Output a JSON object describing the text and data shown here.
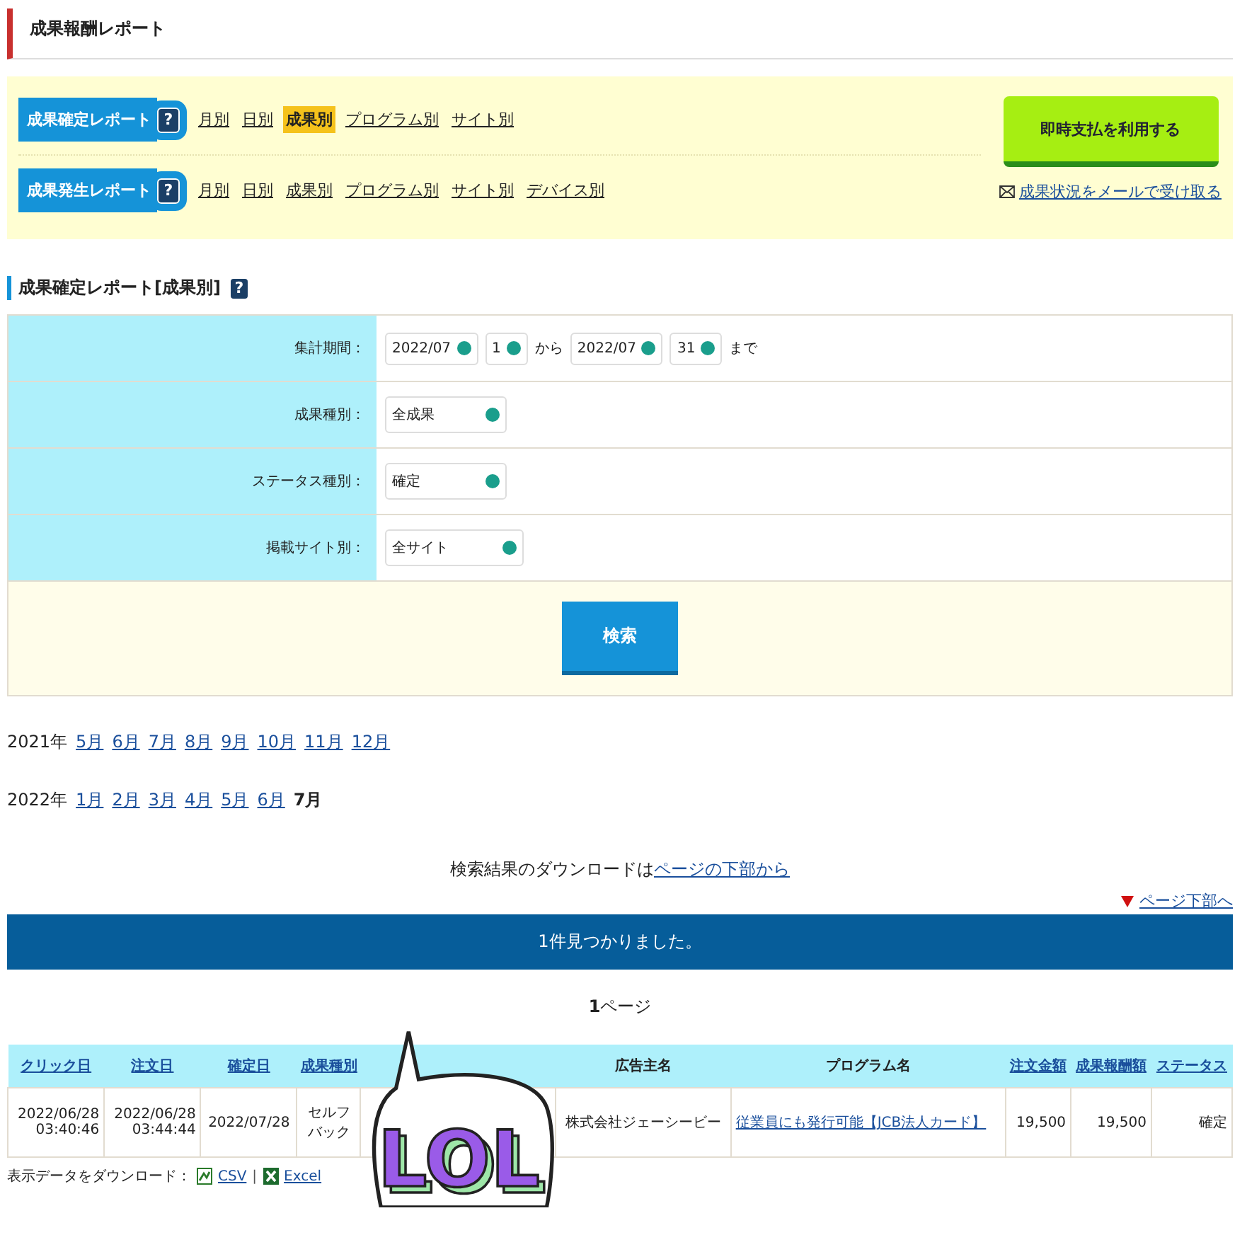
{
  "page_title": "成果報酬レポート",
  "report_nav": [
    {
      "label": "成果確定レポート",
      "help": "?",
      "links": [
        {
          "text": "月別",
          "selected": false
        },
        {
          "text": "日別",
          "selected": false
        },
        {
          "text": "成果別",
          "selected": true
        },
        {
          "text": "プログラム別",
          "selected": false
        },
        {
          "text": "サイト別",
          "selected": false
        }
      ]
    },
    {
      "label": "成果発生レポート",
      "help": "?",
      "links": [
        {
          "text": "月別",
          "selected": false
        },
        {
          "text": "日別",
          "selected": false
        },
        {
          "text": "成果別",
          "selected": false
        },
        {
          "text": "プログラム別",
          "selected": false
        },
        {
          "text": "サイト別",
          "selected": false
        },
        {
          "text": "デバイス別",
          "selected": false
        }
      ]
    }
  ],
  "instant_pay_button": "即時支払を利用する",
  "mail_link": "成果状況をメールで受け取る",
  "section_title": "成果確定レポート[成果別]",
  "section_help": "?",
  "filters": [
    {
      "label": "集計期間：",
      "kind": "range",
      "from_month": "2022/07",
      "from_day": "1",
      "from_sep": "から",
      "to_month": "2022/07",
      "to_day": "31",
      "to_sep": "まで"
    },
    {
      "label": "成果種別：",
      "kind": "select",
      "value": "全成果"
    },
    {
      "label": "ステータス種別：",
      "kind": "select",
      "value": "確定"
    },
    {
      "label": "掲載サイト別：",
      "kind": "select",
      "value": "全サイト"
    }
  ],
  "search_button": "検索",
  "month_rows": [
    {
      "year": "2021年",
      "months": [
        {
          "text": "5月",
          "selected": false
        },
        {
          "text": "6月",
          "selected": false
        },
        {
          "text": "7月",
          "selected": false
        },
        {
          "text": "8月",
          "selected": false
        },
        {
          "text": "9月",
          "selected": false
        },
        {
          "text": "10月",
          "selected": false
        },
        {
          "text": "11月",
          "selected": false
        },
        {
          "text": "12月",
          "selected": false
        }
      ]
    },
    {
      "year": "2022年",
      "months": [
        {
          "text": "1月",
          "selected": false
        },
        {
          "text": "2月",
          "selected": false
        },
        {
          "text": "3月",
          "selected": false
        },
        {
          "text": "4月",
          "selected": false
        },
        {
          "text": "5月",
          "selected": false
        },
        {
          "text": "6月",
          "selected": false
        },
        {
          "text": "7月",
          "selected": true
        }
      ]
    }
  ],
  "download_note": {
    "text": "検索結果のダウンロードは",
    "link": "ページの下部から"
  },
  "page_bottom_link": "ページ下部へ",
  "result_banner": "1件見つかりました。",
  "page_indicator": {
    "number": "1",
    "suffix": "ページ"
  },
  "table": {
    "columns": [
      {
        "label": "クリック日",
        "sortable": true
      },
      {
        "label": "注文日",
        "sortable": true
      },
      {
        "label": "確定日",
        "sortable": true
      },
      {
        "label": "成果種別",
        "sortable": true
      },
      {
        "label": "広告主名",
        "sortable": false
      },
      {
        "label": "プログラム名",
        "sortable": false
      },
      {
        "label": "注文金額",
        "sortable": true
      },
      {
        "label": "成果報酬額",
        "sortable": true
      },
      {
        "label": "ステータス",
        "sortable": true
      }
    ],
    "rows": [
      {
        "cells": [
          "2022/06/28\n03:40:46",
          "2022/06/28\n03:44:44",
          "2022/07/28",
          "セルフバック",
          "株式会社ジェーシービー",
          "従業員にも発行可能【JCB法人カード】",
          "19,500",
          "19,500",
          "確定"
        ]
      }
    ]
  },
  "export": {
    "label": "表示データをダウンロード：",
    "csv": "CSV",
    "separator": "|",
    "excel": "Excel"
  },
  "sticker": {
    "text": "LOL"
  }
}
